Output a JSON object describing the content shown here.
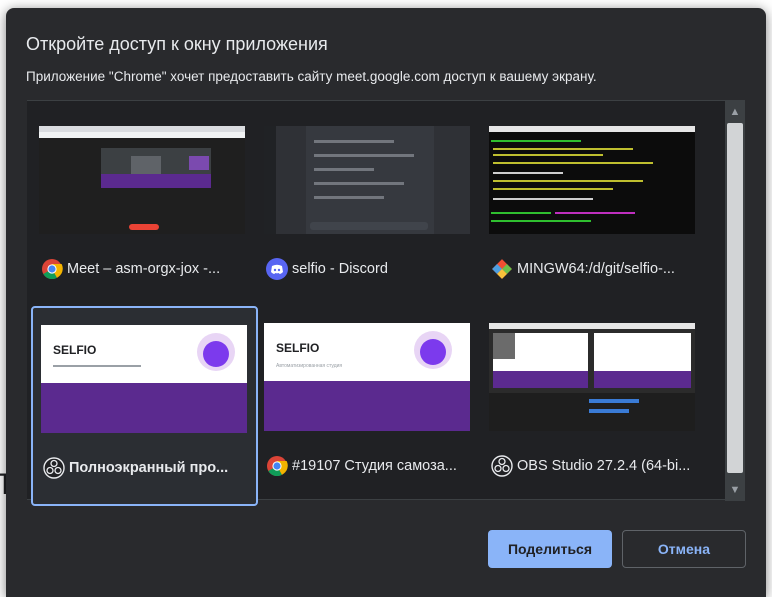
{
  "dialog": {
    "title": "Откройте доступ к окну приложения",
    "subtitle": "Приложение \"Chrome\" хочет предоставить сайту meet.google.com доступ к вашему экрану."
  },
  "windows": [
    {
      "label": "Meet – asm-orgx-jox -...",
      "icon": "chrome-icon",
      "selected": false
    },
    {
      "label": "selfio - Discord",
      "icon": "discord-icon",
      "selected": false
    },
    {
      "label": "MINGW64:/d/git/selfio-...",
      "icon": "git-bash-icon",
      "selected": false
    },
    {
      "label": "Полноэкранный про...",
      "icon": "obs-icon",
      "selected": true
    },
    {
      "label": "#19107 Студия самоза...",
      "icon": "chrome-icon",
      "selected": false
    },
    {
      "label": "OBS Studio 27.2.4 (64-bi...",
      "icon": "obs-icon",
      "selected": false
    }
  ],
  "thumbs": {
    "selfio_brand": "SELFIO",
    "selfio_tagline": "Автоматизированная студия"
  },
  "background": {
    "partial_letter": "Т"
  },
  "buttons": {
    "share": "Поделиться",
    "cancel": "Отмена"
  },
  "colors": {
    "accent": "#8ab4f8",
    "dialog_bg": "#292a2d",
    "list_bg": "#202124",
    "selfio_purple": "#5b2a8f"
  }
}
